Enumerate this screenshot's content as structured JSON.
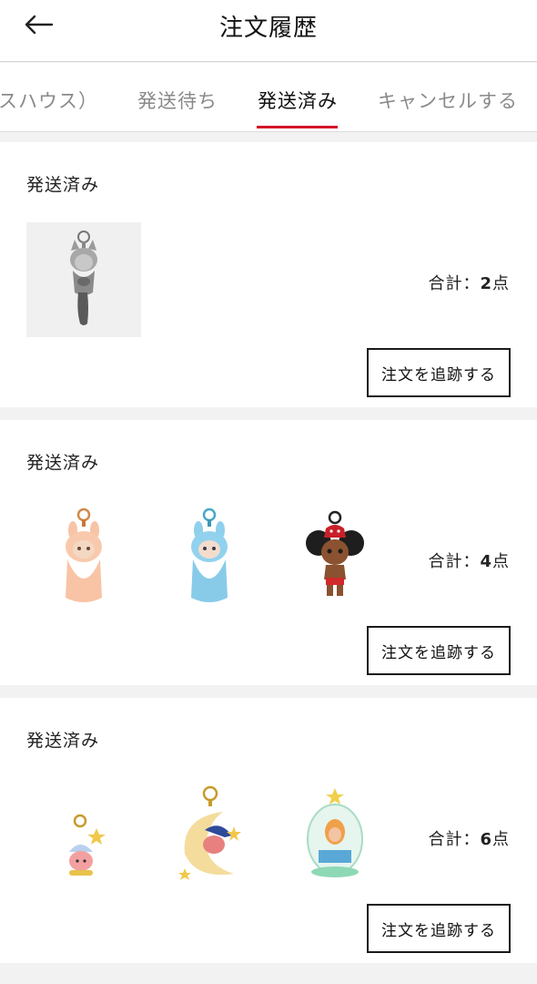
{
  "header": {
    "title": "注文履歴",
    "back_icon": "arrow-left-icon"
  },
  "tabs": [
    {
      "label": "スハウス）",
      "active": false
    },
    {
      "label": "発送待ち",
      "active": false
    },
    {
      "label": "発送済み",
      "active": true
    },
    {
      "label": "キャンセルする",
      "active": false
    }
  ],
  "accent_color": "#d4142a",
  "orders": [
    {
      "status": "発送済み",
      "total_prefix": "合計：",
      "total_count": "2",
      "total_suffix": "点",
      "track_label": "注文を追跡する",
      "items": [
        "grey-fox-keychain-figure"
      ]
    },
    {
      "status": "発送済み",
      "total_prefix": "合計：",
      "total_count": "4",
      "total_suffix": "点",
      "track_label": "注文を追跡する",
      "items": [
        "peach-plush-keychain",
        "blue-plush-keychain",
        "curly-hair-doll-keychain"
      ]
    },
    {
      "status": "発送済み",
      "total_prefix": "合計：",
      "total_count": "6",
      "total_suffix": "点",
      "track_label": "注文を追跡する",
      "items": [
        "star-kid-keychain",
        "moon-sleeper-keychain",
        "capsule-figure-keychain"
      ]
    }
  ]
}
